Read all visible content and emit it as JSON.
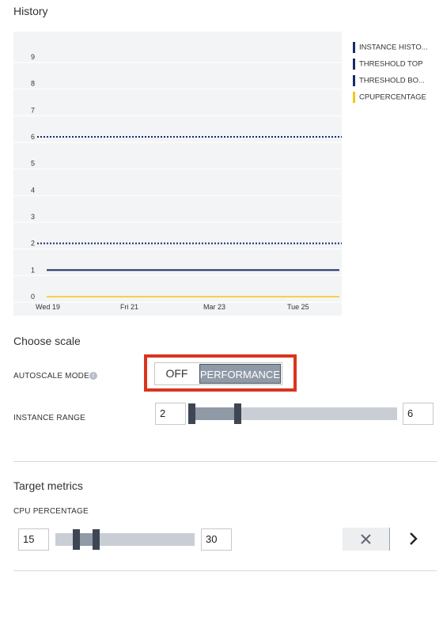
{
  "history": {
    "title": "History",
    "y_ticks": [
      "9",
      "8",
      "7",
      "6",
      "5",
      "4",
      "3",
      "2",
      "1",
      "0"
    ],
    "x_ticks": [
      "Wed 19",
      "Fri 21",
      "Mar 23",
      "Tue 25"
    ],
    "legend": [
      {
        "label": "INSTANCE HISTO...",
        "color": "#1b2a6b"
      },
      {
        "label": "THRESHOLD TOP",
        "color": "#1b2a6b"
      },
      {
        "label": "THRESHOLD BO...",
        "color": "#1b2a6b"
      },
      {
        "label": "CPUPERCENTAGE",
        "color": "#f2c811"
      }
    ]
  },
  "chart_data": {
    "type": "line",
    "x": [
      "Wed 19",
      "Fri 21",
      "Mar 23",
      "Tue 25"
    ],
    "ylim": [
      0,
      9.5
    ],
    "series": [
      {
        "name": "INSTANCE HISTO...",
        "style": "solid",
        "color": "#1b2a6b",
        "values": [
          1,
          1,
          1,
          1
        ]
      },
      {
        "name": "THRESHOLD TOP",
        "style": "dotted",
        "color": "#1b2a6b",
        "values": [
          6,
          6,
          6,
          6
        ]
      },
      {
        "name": "THRESHOLD BO...",
        "style": "dotted",
        "color": "#1b2a6b",
        "values": [
          2,
          2,
          2,
          2
        ]
      },
      {
        "name": "CPUPERCENTAGE",
        "style": "solid",
        "color": "#f2c811",
        "values": [
          0,
          0,
          0,
          0
        ]
      }
    ],
    "grid": true
  },
  "scale": {
    "title": "Choose scale",
    "autoscale_label": "AUTOSCALE MODE",
    "info_icon": "info-icon",
    "mode_off": "OFF",
    "mode_on": "PERFORMANCE",
    "selected_mode": "PERFORMANCE",
    "instance_range_label": "INSTANCE RANGE",
    "instance_min": "2",
    "instance_max": "6"
  },
  "metrics": {
    "title": "Target metrics",
    "cpu_label": "CPU PERCENTAGE",
    "cpu_min": "15",
    "cpu_max": "30",
    "clear_icon": "close-icon",
    "next_icon": "chevron-right-icon"
  }
}
